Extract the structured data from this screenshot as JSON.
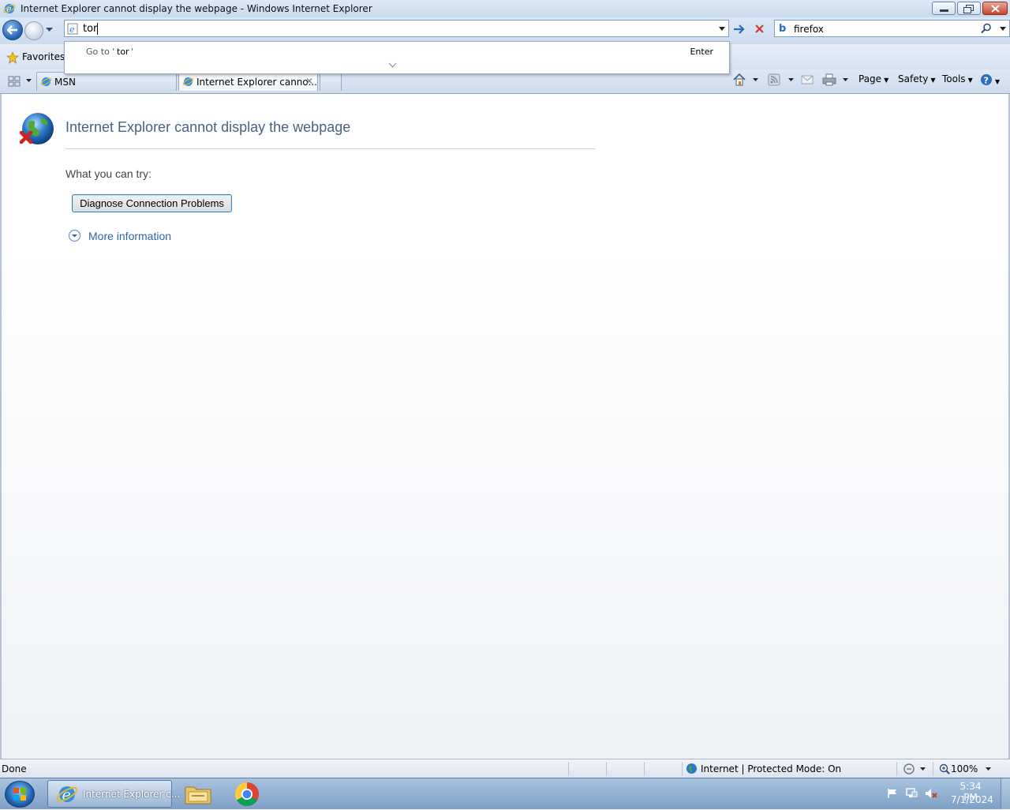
{
  "window": {
    "title": "Internet Explorer cannot display the webpage - Windows Internet Explorer"
  },
  "address": {
    "value": "tor",
    "icon": "ie-page-icon"
  },
  "autocomplete": {
    "goto_prefix": "Go to '",
    "term": "tor",
    "goto_suffix": "'",
    "action": "Enter"
  },
  "search": {
    "value": "firefox",
    "provider_icon": "bing-icon"
  },
  "favorites": {
    "label": "Favorites"
  },
  "tabs": [
    {
      "label": "MSN",
      "active": false
    },
    {
      "label": "Internet Explorer canno...",
      "active": true
    }
  ],
  "commands": {
    "page": "Page",
    "safety": "Safety",
    "tools": "Tools"
  },
  "error_page": {
    "title": "Internet Explorer cannot display the webpage",
    "try_label": "What you can try:",
    "diagnose_button": "Diagnose Connection Problems",
    "more_info": "More information"
  },
  "status": {
    "left": "Done",
    "zone": "Internet | Protected Mode: On",
    "zoom": "100%"
  },
  "taskbar": {
    "ie_label": "Internet Explorer c...",
    "time": "5:34 PM",
    "date": "7/1/2024"
  },
  "colors": {
    "title_link": "#4a6184",
    "link": "#2c64a8",
    "taskbar": "#8aa8cc"
  }
}
